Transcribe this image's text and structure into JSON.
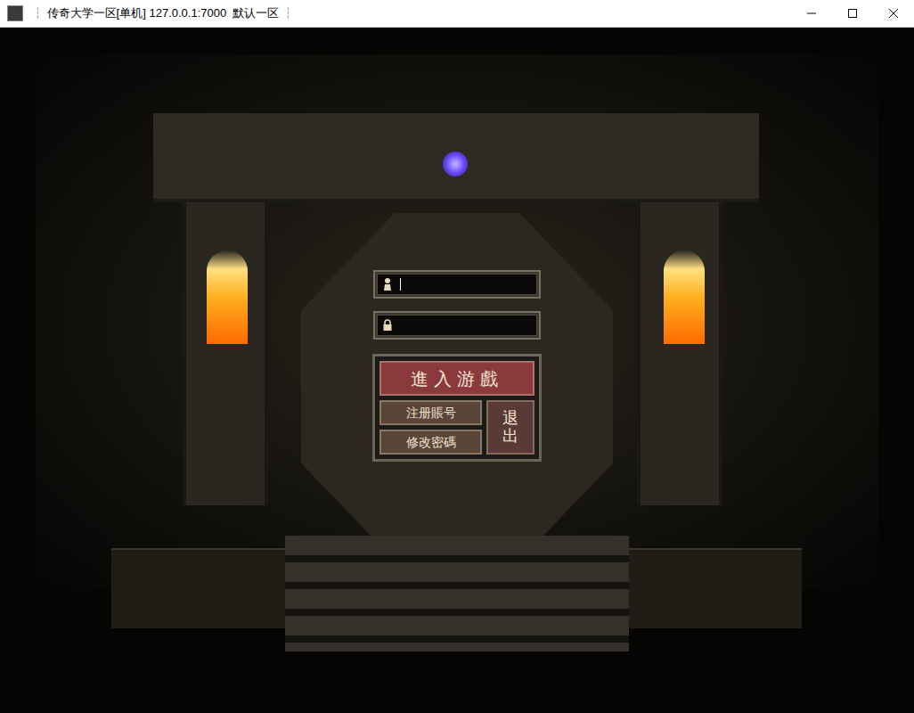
{
  "window": {
    "title": "┆ 传奇大学一区[单机] 127.0.0.1:7000  默认一区 ┆"
  },
  "login": {
    "fields": [
      {
        "kind": "account",
        "value": "",
        "focused": true
      },
      {
        "kind": "password",
        "value": "",
        "focused": false
      }
    ],
    "enter_button": {
      "label": "進入游戲"
    },
    "side_buttons": [
      {
        "label": "注册賬号"
      },
      {
        "label": "修改密碼"
      }
    ],
    "exit_button": {
      "label": "退出"
    }
  }
}
